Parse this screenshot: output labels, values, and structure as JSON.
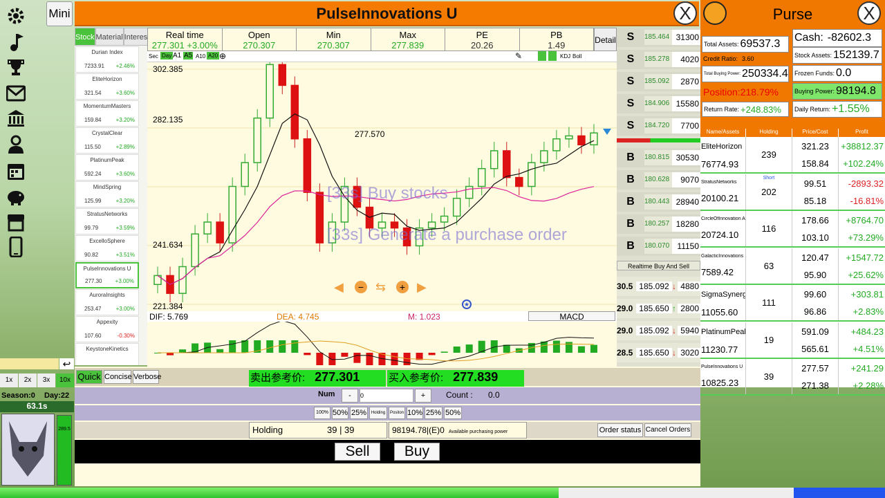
{
  "title": "PulseInnovations U",
  "mini_label": "Mini",
  "close_label": "X",
  "tabs": [
    "Stock",
    "Material",
    "Interest"
  ],
  "stocks": [
    {
      "name": "Durian Index",
      "price": "7233.91",
      "change": "+2.46%"
    },
    {
      "name": "EliteHorizon",
      "price": "321.54",
      "change": "+3.60%"
    },
    {
      "name": "MomentumMasters",
      "price": "159.84",
      "change": "+3.20%"
    },
    {
      "name": "CrystalClear",
      "price": "115.50",
      "change": "+2.89%"
    },
    {
      "name": "PlatinumPeak",
      "price": "592.24",
      "change": "+3.60%"
    },
    {
      "name": "MindSpring",
      "price": "125.99",
      "change": "+3.20%"
    },
    {
      "name": "StratusNetworks",
      "price": "99.79",
      "change": "+3.59%"
    },
    {
      "name": "ExcelloSphere",
      "price": "90.82",
      "change": "+3.51%"
    },
    {
      "name": "PulseInnovations U",
      "price": "277.30",
      "change": "+3.00%"
    },
    {
      "name": "AuroraInsights",
      "price": "253.47",
      "change": "+3.00%"
    },
    {
      "name": "Appexity",
      "price": "107.60",
      "change": "-0.30%"
    },
    {
      "name": "KeystoneKinetics",
      "price": "",
      "change": ""
    }
  ],
  "info": [
    {
      "label": "Real time",
      "value": "277.301 +3.00%"
    },
    {
      "label": "Open",
      "value": "270.307"
    },
    {
      "label": "Min",
      "value": "270.307"
    },
    {
      "label": "Max",
      "value": "277.839"
    },
    {
      "label": "PE",
      "value": "20.26"
    },
    {
      "label": "PB",
      "value": "1.49"
    }
  ],
  "detail_label": "Detail",
  "toolbar": [
    "Sec",
    "Day",
    "A1",
    "A5",
    "A10",
    "A20"
  ],
  "toolbar_right": [
    "KDJ",
    "Boll"
  ],
  "chart_labels": {
    "top": "302.385",
    "mid": "282.135",
    "peak": "277.570",
    "low1": "241.634",
    "low2": "221.384"
  },
  "overlay_texts": [
    "[33s]  Buy stocks",
    "[33s]  Generate a purchase order"
  ],
  "macd": {
    "dif": "DIF: 5.769",
    "dea": "DEA: 4.745",
    "m": "M: 1.023",
    "label": "MACD"
  },
  "chart_data": {
    "type": "candlestick",
    "y_axis_labels": [
      "302.385",
      "282.135",
      "241.634",
      "221.384"
    ],
    "ylim": [
      221.384,
      302.385
    ],
    "candles_note": "approximate OHLC sequence read from chart",
    "values": [
      232,
      226,
      235,
      246,
      250,
      243,
      262,
      270,
      285,
      303,
      296,
      278,
      260,
      243,
      250,
      262,
      255,
      248,
      250,
      248,
      242,
      248,
      250,
      252,
      258,
      262,
      268,
      274,
      265,
      262,
      270,
      274,
      278,
      279,
      276,
      280
    ]
  },
  "orderbook": {
    "sells": [
      [
        "S",
        "185.464",
        "31300"
      ],
      [
        "S",
        "185.278",
        "4020"
      ],
      [
        "S",
        "185.092",
        "2870"
      ],
      [
        "S",
        "184.906",
        "15580"
      ],
      [
        "S",
        "184.720",
        "7700"
      ]
    ],
    "buys": [
      [
        "B",
        "180.815",
        "30530"
      ],
      [
        "B",
        "180.628",
        "9070"
      ],
      [
        "B",
        "180.443",
        "28940"
      ],
      [
        "B",
        "180.257",
        "18280"
      ],
      [
        "B",
        "180.070",
        "11150"
      ]
    ],
    "realtime_label": "Realtime Buy And Sell",
    "trades": [
      [
        "30.5",
        "185.092",
        "4880"
      ],
      [
        "29.0",
        "185.650",
        "2800"
      ],
      [
        "29.0",
        "185.092",
        "5940"
      ],
      [
        "28.5",
        "185.650",
        "3020"
      ]
    ]
  },
  "purse": {
    "title": "Purse",
    "total_assets_label": "Total Assets:",
    "total_assets": "69537.3",
    "cash_label": "Cash:",
    "cash": "-82602.3",
    "credit_label": "Credit Ratio:",
    "credit": "3.60",
    "stock_assets_label": "Stock Assets:",
    "stock_assets": "152139.7",
    "tbp_label": "Total Buying Power:",
    "tbp": "250334.4",
    "frozen_label": "Frozen Funds:",
    "frozen": "0.0",
    "position_label": "Position:",
    "position": "218.79%",
    "bp_label": "Buying Power:",
    "bp": "98194.8",
    "return_label": "Return Rate:",
    "return": "+248.83%",
    "daily_label": "Daily Return:",
    "daily": "+1.55%"
  },
  "holdings_headers": [
    "Name/Assets",
    "Holding",
    "Price/Cost",
    "Profit"
  ],
  "holdings": [
    {
      "name": "EliteHorizon",
      "assets": "76774.93",
      "holding": "239",
      "price": "321.23",
      "cost": "158.84",
      "profit": "+38812.37",
      "pct": "+102.24%",
      "short": ""
    },
    {
      "name": "StratusNetworks",
      "assets": "20100.21",
      "holding": "202",
      "price": "99.51",
      "cost": "85.18",
      "profit": "-2893.32",
      "pct": "-16.81%",
      "short": "Short"
    },
    {
      "name": "CircleOfInnovation A",
      "assets": "20724.10",
      "holding": "116",
      "price": "178.66",
      "cost": "103.10",
      "profit": "+8764.70",
      "pct": "+73.29%",
      "short": ""
    },
    {
      "name": "GalacticInnovations",
      "assets": "7589.42",
      "holding": "63",
      "price": "120.47",
      "cost": "95.90",
      "profit": "+1547.72",
      "pct": "+25.62%",
      "short": ""
    },
    {
      "name": "SigmaSynergies",
      "assets": "11055.60",
      "holding": "111",
      "price": "99.60",
      "cost": "96.86",
      "profit": "+303.81",
      "pct": "+2.83%",
      "short": ""
    },
    {
      "name": "PlatinumPeak",
      "assets": "11230.77",
      "holding": "19",
      "price": "591.09",
      "cost": "565.61",
      "profit": "+484.23",
      "pct": "+4.51%",
      "short": ""
    },
    {
      "name": "PulseInnovations U",
      "assets": "10825.23",
      "holding": "39",
      "price": "277.57",
      "cost": "271.38",
      "profit": "+241.29",
      "pct": "+2.28%",
      "short": ""
    }
  ],
  "trade": {
    "modes": [
      "Quick",
      "Concise",
      "Verbose"
    ],
    "sell_ref_label": "卖出参考价:",
    "sell_ref": "277.301",
    "buy_ref_label": "买入参考价:",
    "buy_ref": "277.839",
    "num_label": "Num",
    "minus": "-",
    "num_value": "0",
    "plus": "+",
    "count_label": "Count :",
    "count_value": "0.0",
    "pcts": [
      "100%",
      "50%",
      "25%",
      "Holding",
      "Positon",
      "10%",
      "25%",
      "50%"
    ],
    "holding_label": "Holding",
    "holding_value": "39 | 39",
    "avail_value": "98194.78|(E)0",
    "avail_label": "Available purchasing power",
    "order_status": "Order status",
    "cancel_orders": "Cancel Orders",
    "sell": "Sell",
    "buy": "Buy"
  },
  "speed": [
    "1x",
    "2x",
    "3x",
    "10x"
  ],
  "season": "Season:0",
  "day": "Day:22",
  "timer": "63.1s",
  "side_value": "289.5"
}
